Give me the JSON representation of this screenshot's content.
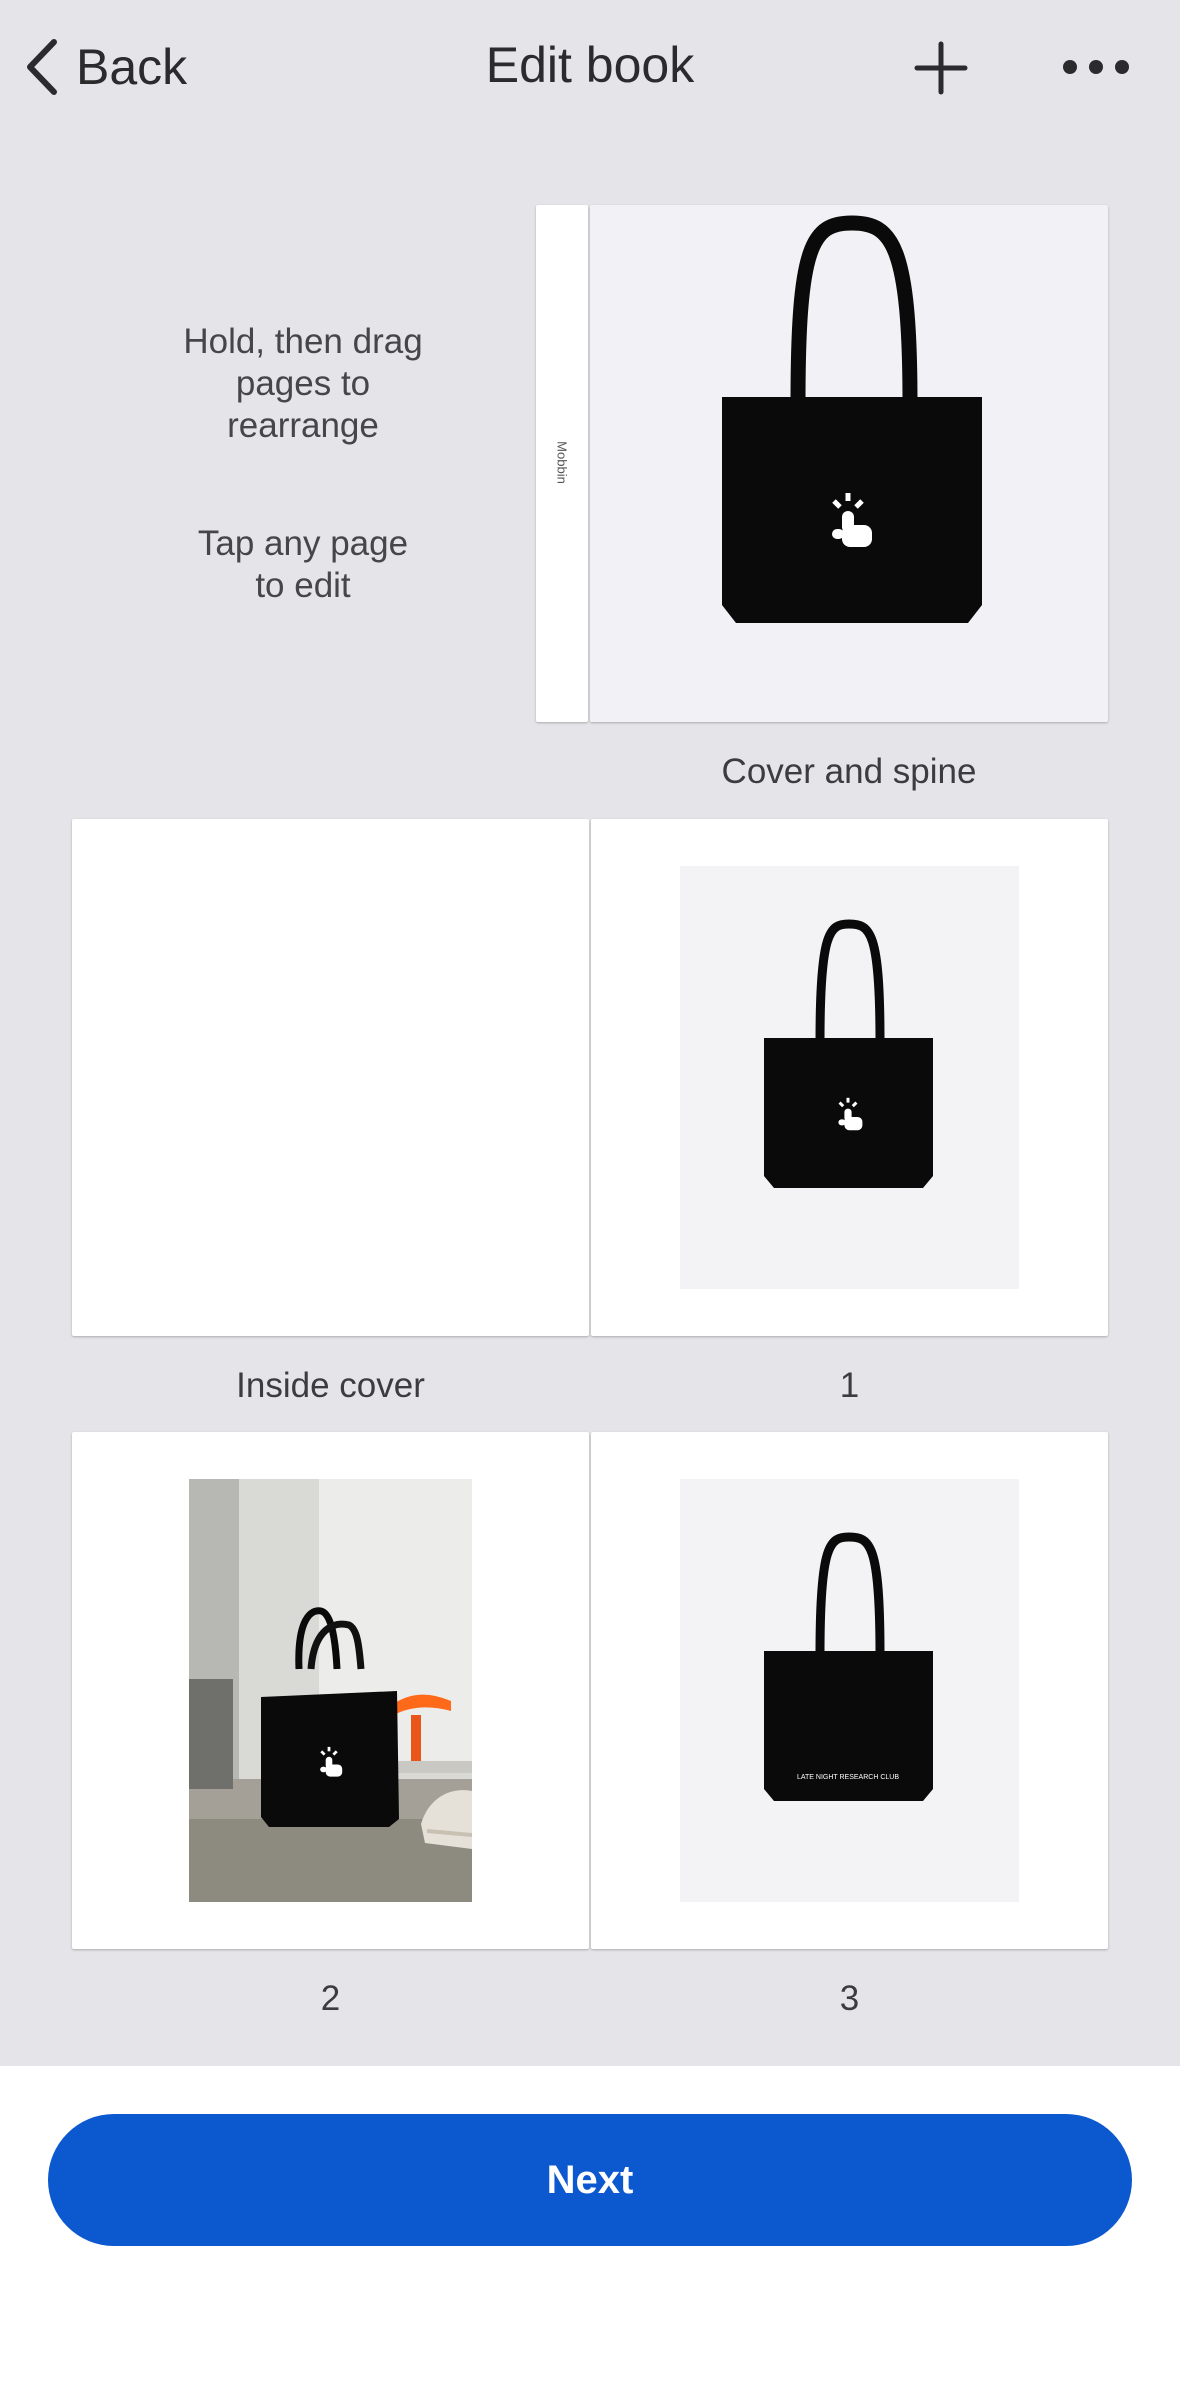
{
  "header": {
    "back_label": "Back",
    "title": "Edit book"
  },
  "hints": {
    "rearrange": [
      "Hold, then drag",
      "pages to",
      "rearrange"
    ],
    "edit": [
      "Tap any page",
      "to edit"
    ]
  },
  "cover": {
    "spine_text": "Mobbin",
    "caption": "Cover and spine"
  },
  "pages": [
    {
      "caption": "Inside cover"
    },
    {
      "caption": "1"
    },
    {
      "caption": "2"
    },
    {
      "caption": "3"
    }
  ],
  "tote_print_text": "LATE NIGHT RESEARCH CLUB",
  "footer": {
    "next_label": "Next"
  },
  "colors": {
    "accent": "#0b58cf",
    "background": "#e5e4e8",
    "lamp": "#ff6a1a"
  }
}
